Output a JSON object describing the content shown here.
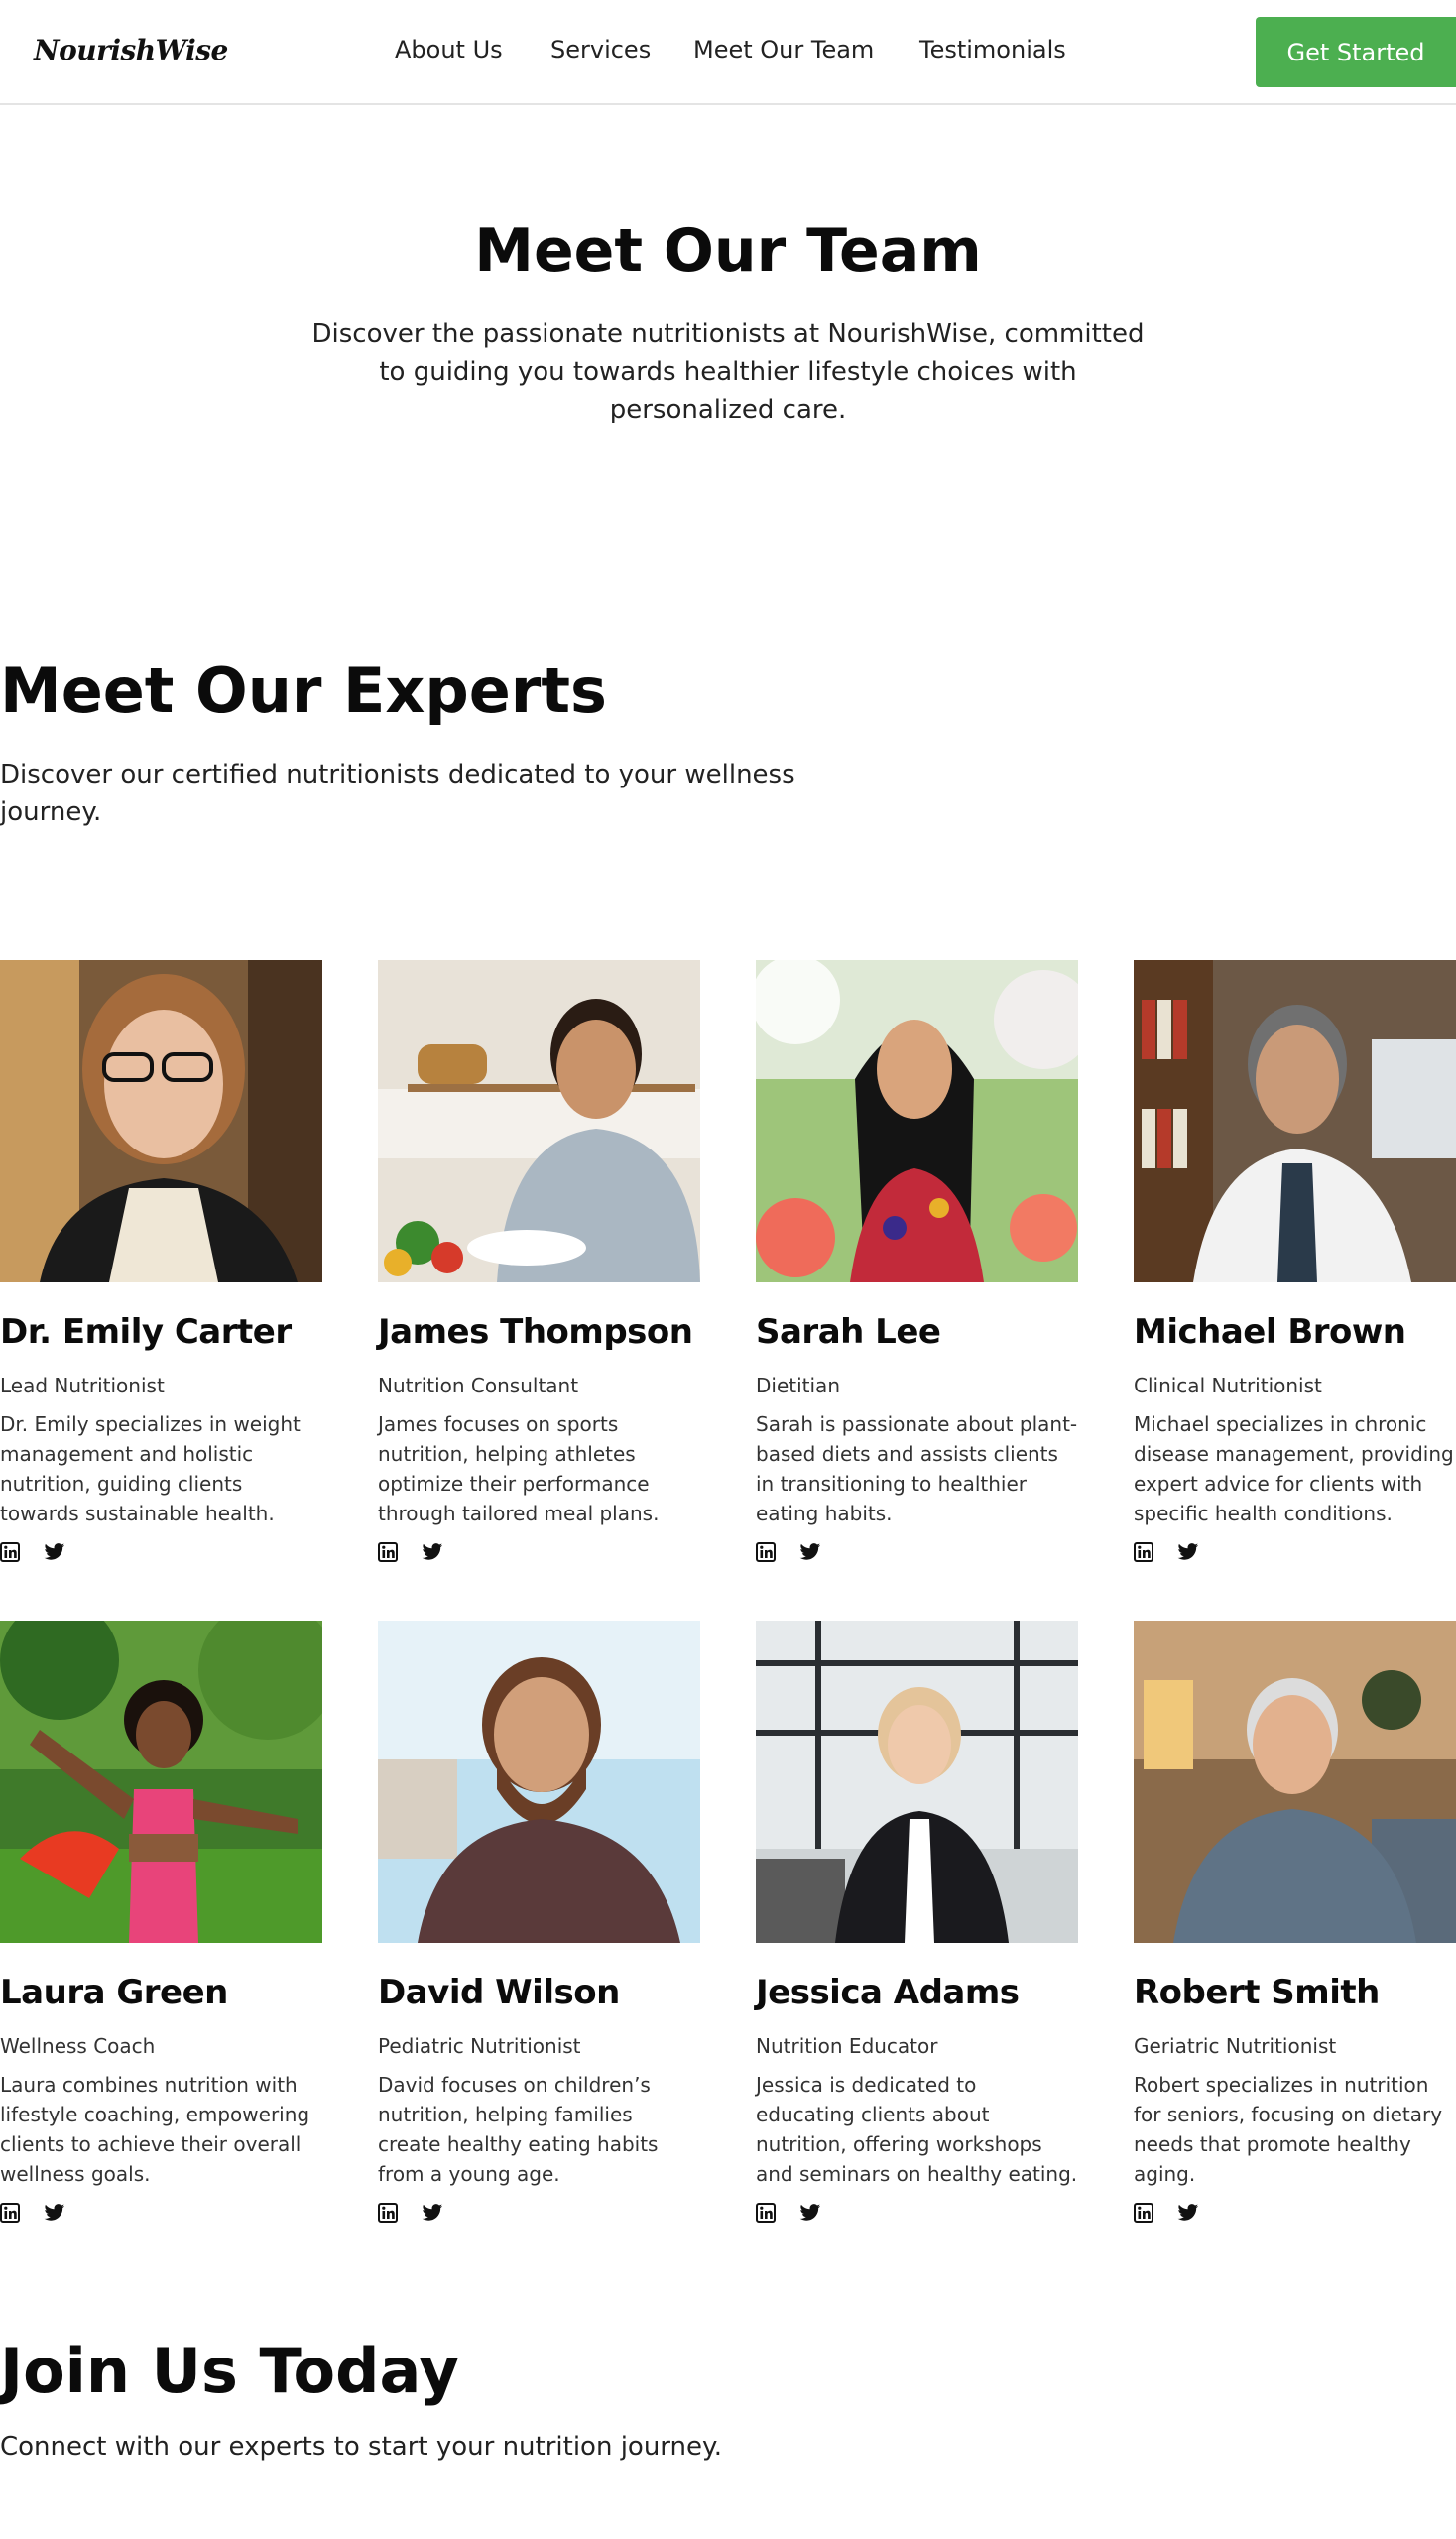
{
  "header": {
    "logo": "NourishWise",
    "nav": [
      "About Us",
      "Services",
      "Meet Our Team",
      "Testimonials"
    ],
    "cta_label": "Get Started",
    "cta_color": "#4caf50"
  },
  "hero": {
    "title": "Meet Our Team",
    "description": "Discover the passionate nutritionists at NourishWise, committed to guiding you towards healthier lifestyle choices with personalized care."
  },
  "experts": {
    "title": "Meet Our Experts",
    "description": "Discover our certified nutritionists dedicated to your wellness journey.",
    "members": [
      {
        "name": "Dr. Emily Carter",
        "role": "Lead Nutritionist",
        "bio": "Dr. Emily specializes in weight management and holistic nutrition, guiding clients towards sustainable health.",
        "social": [
          "linkedin-icon",
          "twitter-icon"
        ]
      },
      {
        "name": "James Thompson",
        "role": "Nutrition Consultant",
        "bio": "James focuses on sports nutrition, helping athletes optimize their performance through tailored meal plans.",
        "social": [
          "linkedin-icon",
          "twitter-icon"
        ]
      },
      {
        "name": "Sarah Lee",
        "role": "Dietitian",
        "bio": "Sarah is passionate about plant-based diets and assists clients in transitioning to healthier eating habits.",
        "social": [
          "linkedin-icon",
          "twitter-icon"
        ]
      },
      {
        "name": "Michael Brown",
        "role": "Clinical Nutritionist",
        "bio": "Michael specializes in chronic disease management, providing expert advice for clients with specific health conditions.",
        "social": [
          "linkedin-icon",
          "twitter-icon"
        ]
      },
      {
        "name": "Laura Green",
        "role": "Wellness Coach",
        "bio": "Laura combines nutrition with lifestyle coaching, empowering clients to achieve their overall wellness goals.",
        "social": [
          "linkedin-icon",
          "twitter-icon"
        ]
      },
      {
        "name": "David Wilson",
        "role": "Pediatric Nutritionist",
        "bio": "David focuses on children’s nutrition, helping families create healthy eating habits from a young age.",
        "social": [
          "linkedin-icon",
          "twitter-icon"
        ]
      },
      {
        "name": "Jessica Adams",
        "role": "Nutrition Educator",
        "bio": "Jessica is dedicated to educating clients about nutrition, offering workshops and seminars on healthy eating.",
        "social": [
          "linkedin-icon",
          "twitter-icon"
        ]
      },
      {
        "name": "Robert Smith",
        "role": "Geriatric Nutritionist",
        "bio": "Robert specializes in nutrition for seniors, focusing on dietary needs that promote healthy aging.",
        "social": [
          "linkedin-icon",
          "twitter-icon"
        ]
      }
    ]
  },
  "join": {
    "title": "Join Us Today",
    "description": "Connect with our experts to start your nutrition journey."
  }
}
